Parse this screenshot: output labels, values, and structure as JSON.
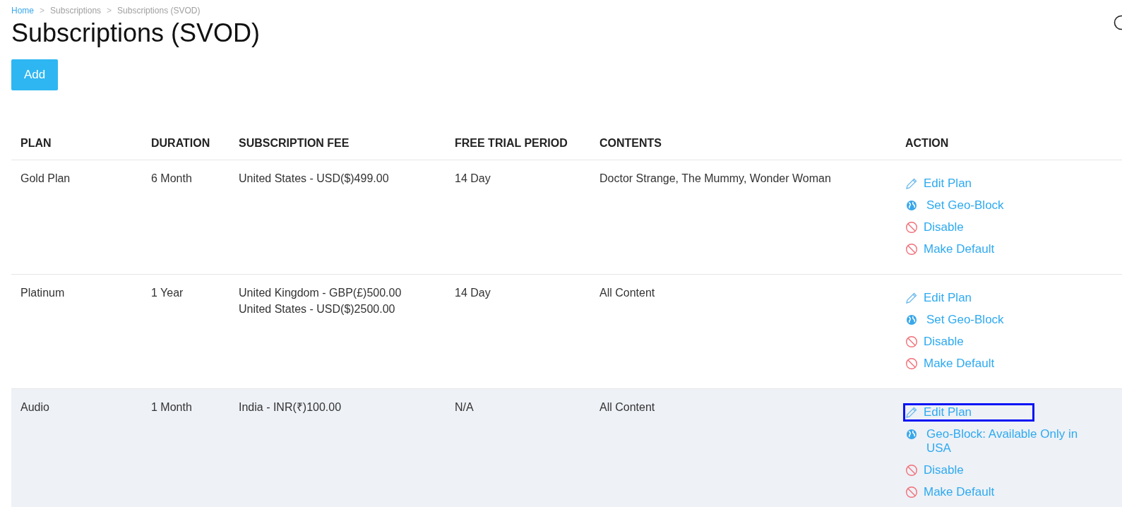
{
  "breadcrumb": [
    {
      "label": "Home",
      "link": true
    },
    {
      "label": "Subscriptions",
      "link": false
    },
    {
      "label": "Subscriptions (SVOD)",
      "link": false
    }
  ],
  "breadcrumb_separators": [
    ">",
    ">"
  ],
  "title": "Subscriptions (SVOD)",
  "add_button": "Add",
  "table": {
    "columns": [
      "PLAN",
      "DURATION",
      "SUBSCRIPTION FEE",
      "FREE TRIAL PERIOD",
      "CONTENTS",
      "ACTION"
    ],
    "rows": [
      {
        "selected": false,
        "plan": "Gold Plan",
        "duration": "6 Month",
        "fees": [
          "United States - USD($)499.00"
        ],
        "trial": "14 Day",
        "contents": "Doctor Strange, The Mummy, Wonder Woman",
        "actions": [
          {
            "kind": "edit",
            "label": "Edit Plan",
            "highlighted": false
          },
          {
            "kind": "geo",
            "label": "Set Geo-Block",
            "highlighted": false
          },
          {
            "kind": "block",
            "label": "Disable",
            "highlighted": false
          },
          {
            "kind": "block",
            "label": "Make Default",
            "highlighted": false
          }
        ]
      },
      {
        "selected": false,
        "plan": "Platinum",
        "duration": "1 Year",
        "fees": [
          "United Kingdom - GBP(£)500.00",
          "United States - USD($)2500.00"
        ],
        "trial": "14 Day",
        "contents": "All Content",
        "actions": [
          {
            "kind": "edit",
            "label": "Edit Plan",
            "highlighted": false
          },
          {
            "kind": "geo",
            "label": "Set Geo-Block",
            "highlighted": false
          },
          {
            "kind": "block",
            "label": "Disable",
            "highlighted": false
          },
          {
            "kind": "block",
            "label": "Make Default",
            "highlighted": false
          }
        ]
      },
      {
        "selected": true,
        "plan": "Audio",
        "duration": "1 Month",
        "fees": [
          "India - INR(₹)100.00"
        ],
        "trial": "N/A",
        "contents": "All Content",
        "actions": [
          {
            "kind": "edit",
            "label": "Edit Plan",
            "highlighted": true
          },
          {
            "kind": "geo",
            "label": "Geo-Block: Available Only in USA",
            "highlighted": false
          },
          {
            "kind": "block",
            "label": "Disable",
            "highlighted": false
          },
          {
            "kind": "block",
            "label": "Make Default",
            "highlighted": false
          }
        ]
      }
    ]
  }
}
